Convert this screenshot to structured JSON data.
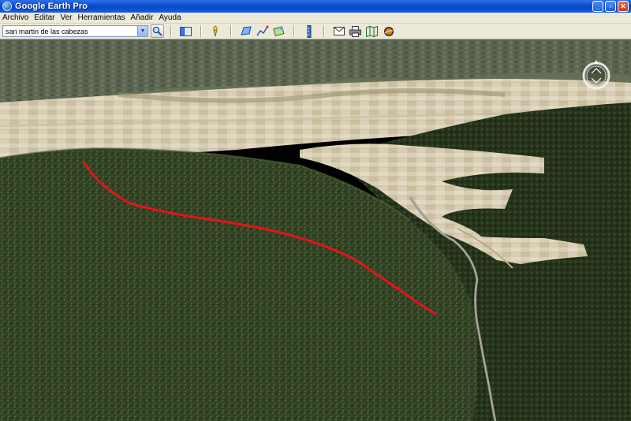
{
  "window": {
    "title": "Google Earth Pro",
    "controls": [
      "minimize",
      "maximize",
      "close"
    ]
  },
  "menu": {
    "items": [
      "Archivo",
      "Editar",
      "Ver",
      "Herramientas",
      "Añadir",
      "Ayuda"
    ]
  },
  "search": {
    "value": "san martin de las cabezas"
  },
  "toolbar": {
    "icons": [
      "sidebar-toggle-icon",
      "placemark-icon",
      "polygon-icon",
      "path-icon",
      "image-overlay-icon",
      "ruler-icon",
      "email-icon",
      "print-icon",
      "maps-icon",
      "sky-icon"
    ]
  },
  "map": {
    "path_color": "#e5131a",
    "compass_label": "N"
  }
}
